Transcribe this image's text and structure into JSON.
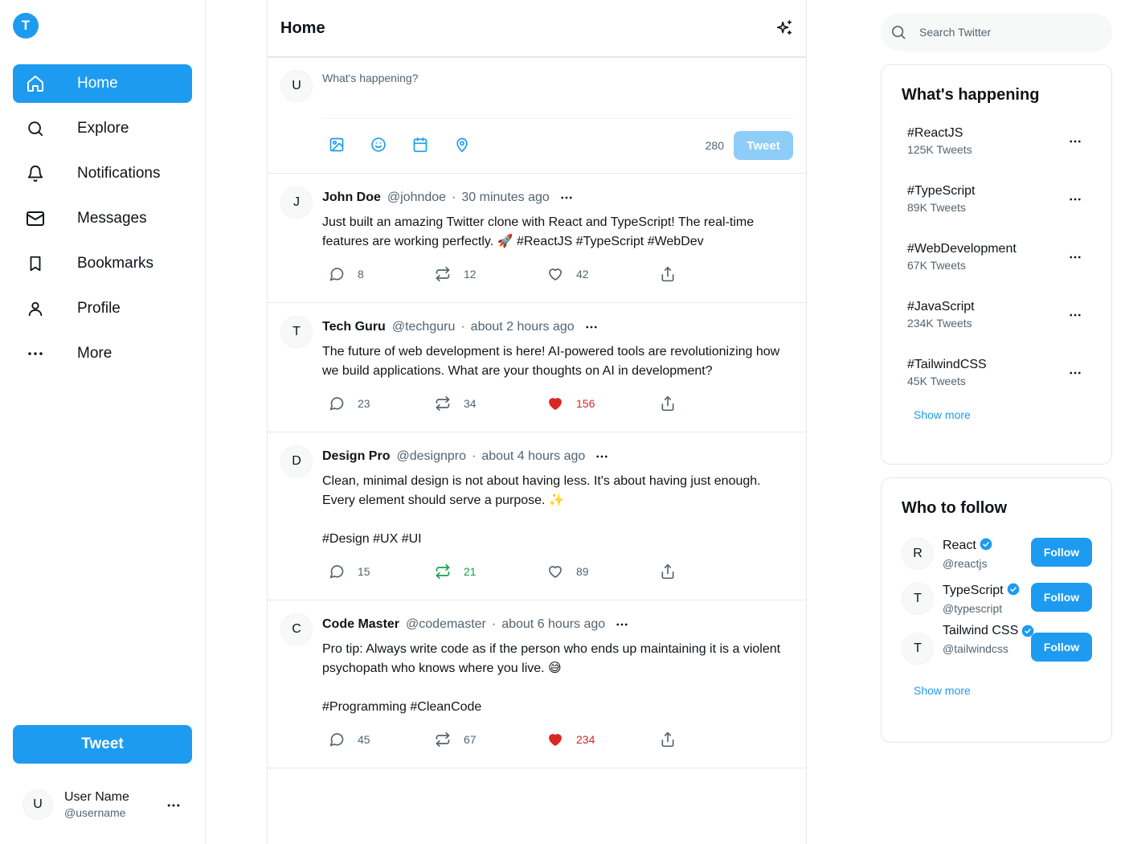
{
  "app": {
    "logo_letter": "T",
    "accent": "#1d9bf0"
  },
  "nav": [
    {
      "label": "Home",
      "icon": "home-icon",
      "active": true
    },
    {
      "label": "Explore",
      "icon": "search-icon"
    },
    {
      "label": "Notifications",
      "icon": "bell-icon"
    },
    {
      "label": "Messages",
      "icon": "mail-icon"
    },
    {
      "label": "Bookmarks",
      "icon": "bookmark-icon"
    },
    {
      "label": "Profile",
      "icon": "user-icon"
    },
    {
      "label": "More",
      "icon": "more-icon"
    }
  ],
  "sidebar": {
    "tweet_label": "Tweet"
  },
  "current_user": {
    "initial": "U",
    "name": "User Name",
    "handle": "@username"
  },
  "feed": {
    "title": "Home",
    "compose": {
      "avatar": "U",
      "placeholder": "What's happening?",
      "char_count": "280",
      "tweet_label": "Tweet"
    },
    "posts": [
      {
        "avatar": "J",
        "name": "John Doe",
        "handle": "@johndoe",
        "time": "30 minutes ago",
        "body": "Just built an amazing Twitter clone with React and TypeScript! The real-time features are working perfectly. 🚀 #ReactJS #TypeScript #WebDev",
        "replies": "8",
        "retweets": "12",
        "likes": "42",
        "liked": false,
        "retweeted": false
      },
      {
        "avatar": "T",
        "name": "Tech Guru",
        "handle": "@techguru",
        "time": "about 2 hours ago",
        "body": "The future of web development is here! AI-powered tools are revolutionizing how we build applications. What are your thoughts on AI in development?",
        "replies": "23",
        "retweets": "34",
        "likes": "156",
        "liked": true,
        "retweeted": false
      },
      {
        "avatar": "D",
        "name": "Design Pro",
        "handle": "@designpro",
        "time": "about 4 hours ago",
        "body": "Clean, minimal design is not about having less. It's about having just enough.\nEvery element should serve a purpose. ✨\n\n#Design #UX #UI",
        "replies": "15",
        "retweets": "21",
        "likes": "89",
        "liked": false,
        "retweeted": true
      },
      {
        "avatar": "C",
        "name": "Code Master",
        "handle": "@codemaster",
        "time": "about 6 hours ago",
        "body": "Pro tip: Always write code as if the person who ends up maintaining it is a violent psychopath who knows where you live. 😅\n\n#Programming #CleanCode",
        "replies": "45",
        "retweets": "67",
        "likes": "234",
        "liked": true,
        "retweeted": false
      }
    ]
  },
  "search": {
    "placeholder": "Search Twitter"
  },
  "trends": {
    "title": "What's happening",
    "items": [
      {
        "tag": "#ReactJS",
        "count": "125K Tweets"
      },
      {
        "tag": "#TypeScript",
        "count": "89K Tweets"
      },
      {
        "tag": "#WebDevelopment",
        "count": "67K Tweets"
      },
      {
        "tag": "#JavaScript",
        "count": "234K Tweets"
      },
      {
        "tag": "#TailwindCSS",
        "count": "45K Tweets"
      }
    ],
    "show_more": "Show more"
  },
  "who_to_follow": {
    "title": "Who to follow",
    "items": [
      {
        "initial": "R",
        "name": "React",
        "handle": "@reactjs",
        "verified": true,
        "button": "Follow"
      },
      {
        "initial": "T",
        "name": "TypeScript",
        "handle": "@typescript",
        "verified": true,
        "button": "Follow"
      },
      {
        "initial": "T",
        "name": "Tailwind CSS",
        "handle": "@tailwindcss",
        "verified": true,
        "button": "Follow"
      }
    ],
    "show_more": "Show more"
  }
}
